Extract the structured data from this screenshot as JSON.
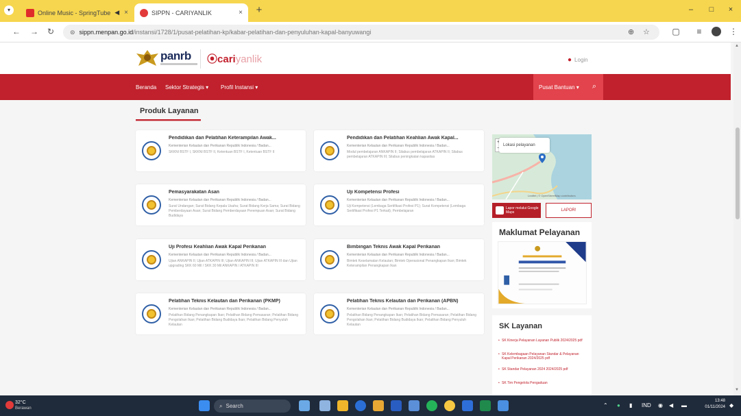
{
  "browser": {
    "tabs": [
      {
        "label": "Online Music - SpringTube",
        "color": "#e02b2b"
      },
      {
        "label": "SIPPN - CARIYANLIK",
        "color": "#e23a3a"
      }
    ],
    "new_tab": "+",
    "url_domain": "sippn.menpan.go.id",
    "url_path": "/instansi/1728/1/pusat-pelatihan-kp/kabar-pelatihan-dan-penyuluhan-kapal-banyuwangi",
    "minimize": "–",
    "maximize": "□",
    "close": "×"
  },
  "header": {
    "logo_panrb": "panrb",
    "logo_cari": "cari",
    "logo_yanlik": "yanlik",
    "login_label": "Login"
  },
  "nav": {
    "items": [
      "Beranda",
      "Sektor Strategis ▾",
      "Profil Instansi ▾"
    ],
    "pusat": "Pusat Bantuan ▾"
  },
  "section_title": "Produk Layanan",
  "cards": [
    {
      "title": "Pendidikan dan Pelatihan Keterampilan Awak...",
      "ministry": "Kementerian Kelautan dan Perikanan Republik Indonesia / Badan...",
      "desc": "SKKNI BSTF I, SKKNI BSTF II, Ketentuan BSTF I, Ketentuan BSTF II"
    },
    {
      "title": "Pendidikan dan Pelatihan Keahlian Awak Kapal...",
      "ministry": "Kementerian Kelautan dan Perikanan Republik Indonesia / Badan...",
      "desc": "Modul pembelajaran ANKAPIN II; Silabus pembelajaran ATKAPIN II; Silabus pembelajaran ATKAPIN III; Silabus peningkatan kapasitas"
    },
    {
      "title": "Pemasyarakatan Asan",
      "ministry": "Kementerian Kelautan dan Perikanan Republik Indonesia / Badan...",
      "desc": "Surat Undangan; Surat Bidang Kepala Usaha; Surat Bidang Kerja Sama; Surat Bidang Pemberdayaan Asan; Surat Bidang Pemberdayaan Perempuan Asan; Surat Bidang Budidaya"
    },
    {
      "title": "Uji Kompetensi Profesi",
      "ministry": "Kementerian Kelautan dan Perikanan Republik Indonesia / Badan...",
      "desc": "Uji Kompetensi (Lembaga Sertifikasi Profesi P1); Surat Kompetensi (Lembaga Sertifikasi Profesi P1 Terkait); Pembelajaran"
    },
    {
      "title": "Uji Profesi Keahlian Awak Kapal Perikanan",
      "ministry": "Kementerian Kelautan dan Perikanan Republik Indonesia / Badan...",
      "desc": "Ujian ANKAPIN II; Ujian ATKAPIN III; Ujian ANKAPIN III; Ujian ATKAPIN III dan Ujian upgrading SKK 60 Mil / SKK 30 Mil ANKAPIN / ATKAPIN III"
    },
    {
      "title": "Bimbingan Teknis Awak Kapal Perikanan",
      "ministry": "Kementerian Kelautan dan Perikanan Republik Indonesia / Badan...",
      "desc": "Bimtek Keselamatan Kelautan; Bimtek Operasional Penangkapan Ikan; Bimtek Keterampilan Penangkapan Ikan"
    },
    {
      "title": "Pelatihan Teknis Kelautan dan Perikanan (PKMP)",
      "ministry": "Kementerian Kelautan dan Perikanan Republik Indonesia / Badan...",
      "desc": "Pelatihan Bidang Penangkapan Ikan; Pelatihan Bidang Pemasaran; Pelatihan Bidang Pengolahan Ikan; Pelatihan Bidang Budidaya Ikan; Pelatihan Bidang Penyuluh Kelautan"
    },
    {
      "title": "Pelatihan Teknis Kelautan dan Perikanan (APBN)",
      "ministry": "Kementerian Kelautan dan Perikanan Republik Indonesia / Badan...",
      "desc": "Pelatihan Bidang Penangkapan Ikan; Pelatihan Bidang Pemasaran; Pelatihan Bidang Pengolahan Ikan; Pelatihan Bidang Budidaya Ikan; Pelatihan Bidang Penyuluh Kelautan"
    }
  ],
  "map": {
    "popup": "Lokasi pelayanan",
    "zoom_in": "+",
    "zoom_out": "−",
    "attribution": "Leaflet | © OpenStreetMap contributors"
  },
  "buttons": {
    "lapor": "Lapor melalui Google Maps",
    "lapor2": "LAPOR!"
  },
  "maklumat_title": "Maklumat Pelayanan",
  "sk_title": "SK Layanan",
  "sk_items": [
    "SK Kinerja Pelayanan Layanan Publik 2024/2025 pdf",
    "SK Kelembagaan Pelayanan Standar & Pelayanan Kapal Perikanan 2024/2025 pdf",
    "SK Standar Pelayanan 2024 2024/2025 pdf",
    "SK Tim Pengelola Pengaduan"
  ],
  "taskbar": {
    "weather_temp": "32°C",
    "weather_desc": "Berawan",
    "search": "Search",
    "lang": "IND",
    "time": "13:48",
    "date": "01/11/2024"
  }
}
